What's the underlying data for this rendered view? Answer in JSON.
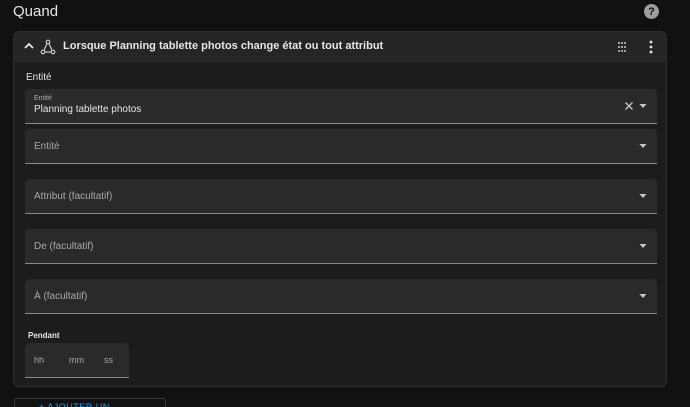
{
  "page": {
    "title": "Quand"
  },
  "help_icon": {
    "glyph": "?"
  },
  "trigger": {
    "header_title": "Lorsque Planning tablette photos change état ou tout attribut",
    "section_label": "Entité",
    "fields": [
      {
        "floating_label": "Entité",
        "value": "Planning tablette photos",
        "has_clear": true
      },
      {
        "placeholder": "Entité"
      },
      {
        "placeholder": "Attribut (facultatif)"
      },
      {
        "placeholder": "De (facultatif)"
      },
      {
        "placeholder": "À (facultatif)"
      }
    ],
    "duration": {
      "label": "Pendant",
      "hours_placeholder": "hh",
      "minutes_placeholder": "mm",
      "seconds_placeholder": "ss"
    }
  },
  "add_button": {
    "label": "+ AJOUTER UN DÉCLENCHEUR"
  },
  "colors": {
    "accent": "#03a9f4",
    "background": "#111111",
    "card": "#1c1c1c",
    "field": "#2a2a2a"
  }
}
